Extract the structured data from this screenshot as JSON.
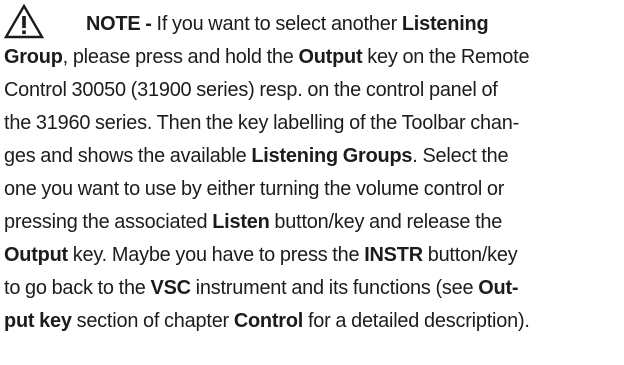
{
  "note": {
    "icon": "warning-triangle-icon",
    "label": "NOTE -",
    "lines": [
      [
        {
          "t": " If you want to select another ",
          "b": false
        },
        {
          "t": "Listening",
          "b": true
        }
      ],
      [
        {
          "t": "Group",
          "b": true
        },
        {
          "t": ", please press and hold the ",
          "b": false
        },
        {
          "t": "Output",
          "b": true
        },
        {
          "t": " key on the Remote",
          "b": false
        }
      ],
      [
        {
          "t": "Control 30050 (31900 series) resp. on the control panel of",
          "b": false
        }
      ],
      [
        {
          "t": "the 31960 series. Then the key labelling of the Toolbar chan-",
          "b": false
        }
      ],
      [
        {
          "t": "ges and shows the available ",
          "b": false
        },
        {
          "t": "Listening Groups",
          "b": true
        },
        {
          "t": ". Select the",
          "b": false
        }
      ],
      [
        {
          "t": "one you want to use by either turning the volume control or",
          "b": false
        }
      ],
      [
        {
          "t": "pressing the associated ",
          "b": false
        },
        {
          "t": "Listen",
          "b": true
        },
        {
          "t": " button/key and release the",
          "b": false
        }
      ],
      [
        {
          "t": "Output",
          "b": true
        },
        {
          "t": " key. Maybe you have to press the ",
          "b": false
        },
        {
          "t": "INSTR",
          "b": true
        },
        {
          "t": " button/key",
          "b": false
        }
      ],
      [
        {
          "t": "to go back to the ",
          "b": false
        },
        {
          "t": "VSC",
          "b": true
        },
        {
          "t": " instrument and its functions (see ",
          "b": false
        },
        {
          "t": "Out-",
          "b": true
        }
      ],
      [
        {
          "t": "put key",
          "b": true
        },
        {
          "t": " section of chapter ",
          "b": false
        },
        {
          "t": "Control",
          "b": true
        },
        {
          "t": " for a detailed description).",
          "b": false
        }
      ]
    ]
  }
}
